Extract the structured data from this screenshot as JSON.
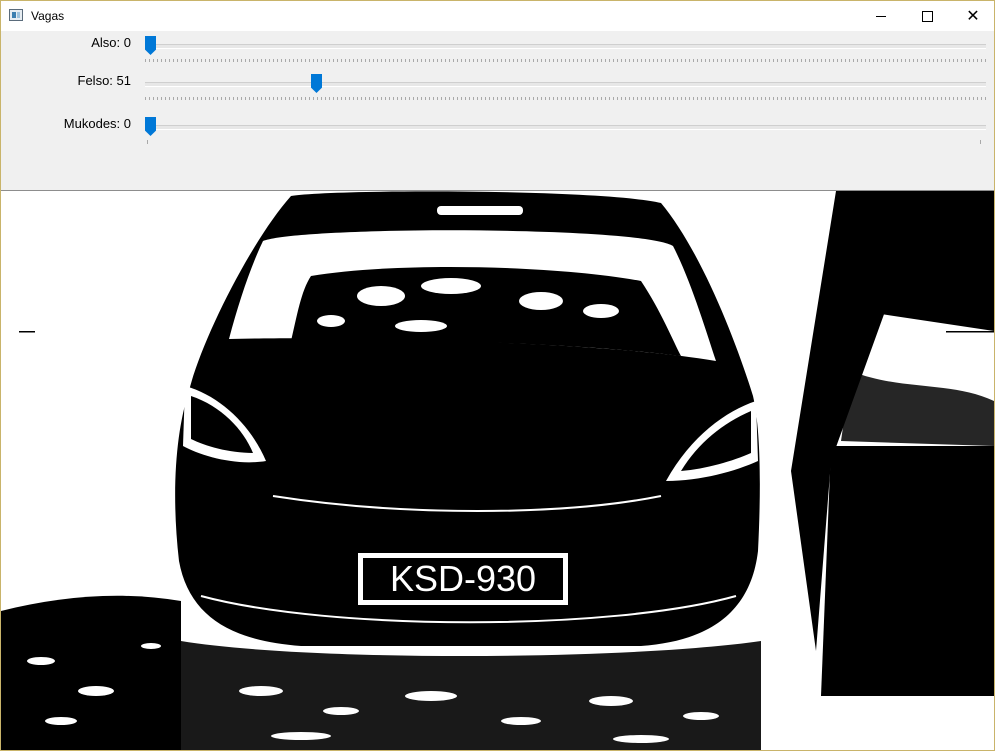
{
  "window": {
    "title": "Vagas",
    "controls": {
      "minimize": "minimize-icon",
      "maximize": "maximize-icon",
      "close": "close-icon"
    }
  },
  "trackbars": [
    {
      "label": "Also: 0",
      "value": 0,
      "max": 255
    },
    {
      "label": "Felso: 51",
      "value": 51,
      "max": 255
    },
    {
      "label": "Mukodes: 0",
      "value": 0,
      "max": 1
    }
  ],
  "image": {
    "plate_text": "KSD-930",
    "colors": {
      "foreground": "#000000",
      "background": "#ffffff"
    }
  }
}
